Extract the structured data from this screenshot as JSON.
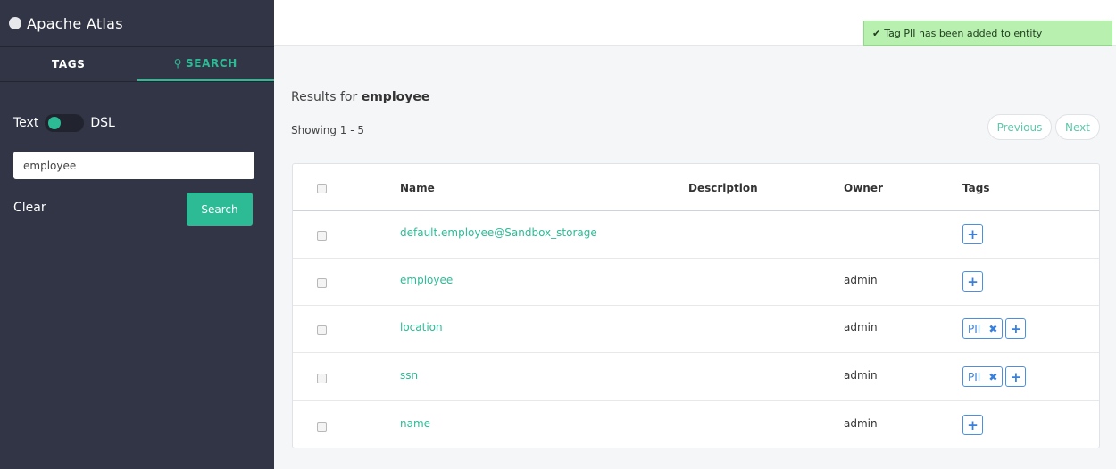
{
  "app": {
    "title": "Apache Atlas"
  },
  "sidebar": {
    "tabs": [
      "TAGS",
      "SEARCH"
    ],
    "toggle_left": "Text",
    "toggle_right": "DSL",
    "search_value": "employee",
    "clear_label": "Clear",
    "search_label": "Search"
  },
  "toast": "Tag PII has been added to entity",
  "main": {
    "results_prefix": "Results for",
    "query": "employee",
    "showing": "Showing 1 - 5",
    "prev": "Previous",
    "next": "Next",
    "columns": [
      "Name",
      "Description",
      "Owner",
      "Tags"
    ],
    "rows": [
      {
        "name": "default.employee@Sandbox_storage",
        "description": "",
        "owner": "",
        "tags": []
      },
      {
        "name": "employee",
        "description": "",
        "owner": "admin",
        "tags": []
      },
      {
        "name": "location",
        "description": "",
        "owner": "admin",
        "tags": [
          "PII"
        ]
      },
      {
        "name": "ssn",
        "description": "",
        "owner": "admin",
        "tags": [
          "PII"
        ]
      },
      {
        "name": "name",
        "description": "",
        "owner": "admin",
        "tags": []
      }
    ]
  },
  "colors": {
    "accent": "#2dbb96",
    "sidebar": "#323546",
    "tag": "#4a90e2",
    "toast": "#b8f0b0"
  }
}
